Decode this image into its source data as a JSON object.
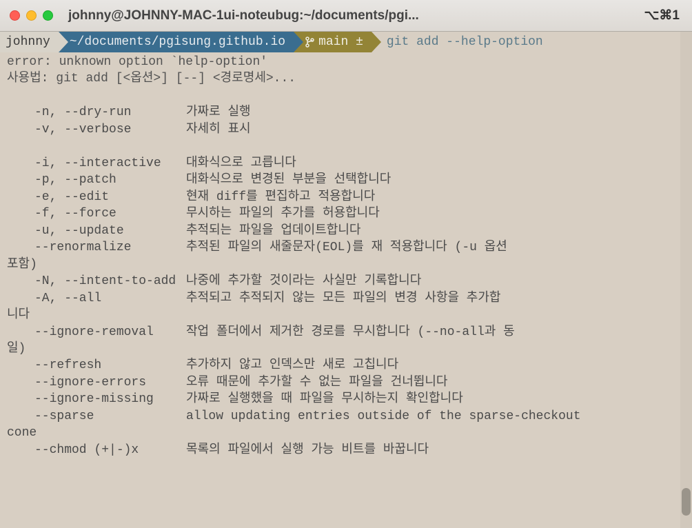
{
  "window": {
    "title": "johnny@JOHNNY-MAC-1ui-noteubug:~/documents/pgi...",
    "shortcut": "⌥⌘1"
  },
  "prompt": {
    "user": "johnny",
    "path": "~/documents/pgisung.github.io",
    "branch": "main ±",
    "command": "git add --help-option"
  },
  "error": "error: unknown option `help-option'",
  "usage": "사용법: git add [<옵션>] [--] <경로명세>...",
  "options": [
    {
      "flag": "-n, --dry-run",
      "desc": "가짜로 실행"
    },
    {
      "flag": "-v, --verbose",
      "desc": "자세히 표시"
    }
  ],
  "options2": [
    {
      "flag": "-i, --interactive",
      "desc": "대화식으로 고릅니다"
    },
    {
      "flag": "-p, --patch",
      "desc": "대화식으로 변경된 부분을 선택합니다"
    },
    {
      "flag": "-e, --edit",
      "desc": "현재 diff를 편집하고 적용합니다"
    },
    {
      "flag": "-f, --force",
      "desc": "무시하는 파일의 추가를 허용합니다"
    },
    {
      "flag": "-u, --update",
      "desc": "추적되는 파일을 업데이트합니다"
    },
    {
      "flag": "--renormalize",
      "desc": "추적된 파일의 새줄문자(EOL)를 재 적용합니다 (-u 옵션 "
    }
  ],
  "wrap1": "포함)",
  "options3": [
    {
      "flag": "-N, --intent-to-add",
      "desc": "나중에 추가할 것이라는 사실만 기록합니다"
    },
    {
      "flag": "-A, --all",
      "desc": "추적되고 추적되지 않는 모든 파일의 변경 사항을 추가합"
    }
  ],
  "wrap2": "니다",
  "options4": [
    {
      "flag": "--ignore-removal",
      "desc": "작업 폴더에서 제거한 경로를 무시합니다 (--no-all과 동"
    }
  ],
  "wrap3": "일)",
  "options5": [
    {
      "flag": "--refresh",
      "desc": "추가하지 않고 인덱스만 새로 고칩니다"
    },
    {
      "flag": "--ignore-errors",
      "desc": "오류 때문에 추가할 수 없는 파일을 건너뜁니다"
    },
    {
      "flag": "--ignore-missing",
      "desc": "가짜로 실행했을 때 파일을 무시하는지 확인합니다"
    },
    {
      "flag": "--sparse",
      "desc": "allow updating entries outside of the sparse-checkout "
    }
  ],
  "wrap4": "cone",
  "options6": [
    {
      "flag": "--chmod (+|-)x",
      "desc": "목록의 파일에서 실행 가능 비트를 바꿉니다"
    }
  ]
}
